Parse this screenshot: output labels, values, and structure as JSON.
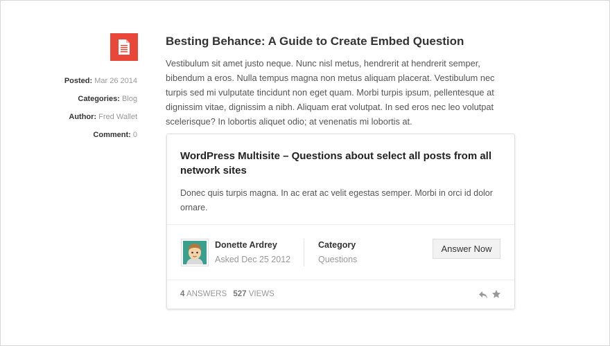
{
  "post": {
    "title": "Besting Behance: A Guide to Create Embed Question",
    "body": "Vestibulum sit amet justo neque. Nunc nisl metus, hendrerit at hendrerit semper, bibendum a eros. Nulla tempus magna non metus aliquam placerat. Vestibulum nec turpis sed mi vulputate tincidunt non eget quam. Morbi turpis ipsum, pellentesque at dignissim vitae, dignissim a nibh. Aliquam erat volutpat. In sed eros nec leo volutpat scelerisque? In lobortis aliquet odio; at venenatis mi lobortis at.",
    "icon": "document-icon",
    "accent_color": "#e9473a"
  },
  "meta": {
    "posted_label": "Posted:",
    "posted_value": "Mar 26 2014",
    "categories_label": "Categories:",
    "categories_value": "Blog",
    "author_label": "Author:",
    "author_value": "Fred Wallet",
    "comment_label": "Comment:",
    "comment_value": "0"
  },
  "question": {
    "title": "WordPress Multisite – Questions about select all posts from all network sites",
    "body": "Donec quis turpis magna. In ac erat ac velit egestas semper. Morbi in orci id dolor ornare.",
    "author_name": "Donette Ardrey",
    "asked": "Asked Dec 25 2012",
    "category_label": "Category",
    "category_value": "Questions",
    "answer_button": "Answer Now",
    "answers_count": "4",
    "answers_label": "ANSWERS",
    "views_count": "527",
    "views_label": "VIEWS",
    "icons": [
      "reply-icon",
      "star-icon"
    ]
  }
}
